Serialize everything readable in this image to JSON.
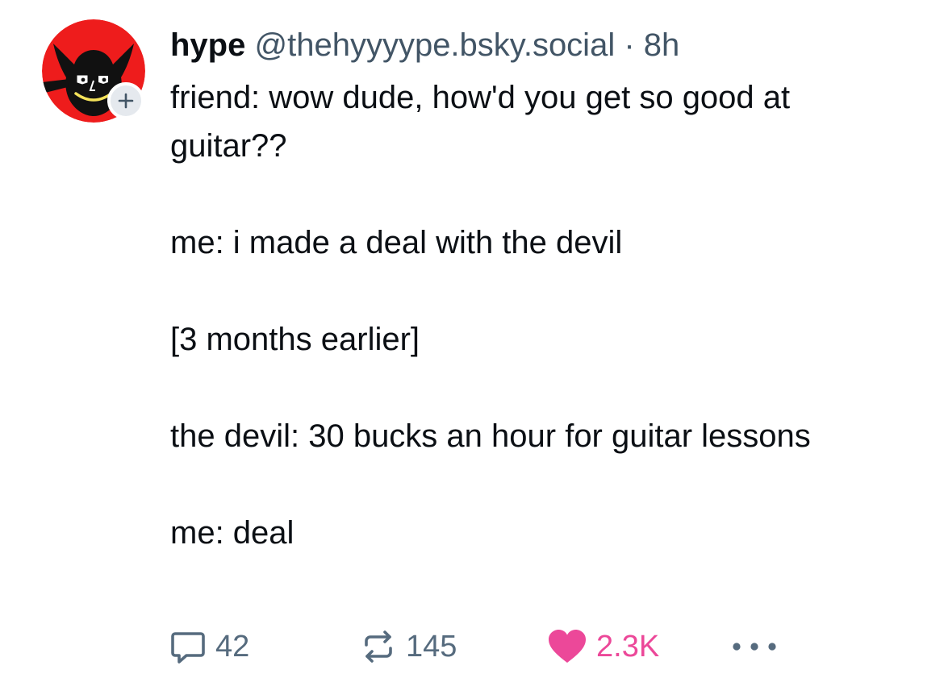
{
  "post": {
    "author": {
      "display_name": "hype",
      "handle": "@thehyyyype.bsky.social",
      "avatar_icon": "devil-face-avatar",
      "follow_icon": "plus-icon"
    },
    "separator": "·",
    "timestamp": "8h",
    "body": {
      "lines": [
        "friend: wow dude, how'd you get so good at guitar??",
        "me: i made a deal with the devil",
        "[3 months earlier]",
        "the devil: 30 bucks an hour for guitar lessons",
        "me: deal"
      ]
    },
    "actions": {
      "reply": {
        "icon": "speech-bubble-icon",
        "count": "42"
      },
      "repost": {
        "icon": "repost-arrows-icon",
        "count": "145"
      },
      "like": {
        "icon": "heart-icon",
        "count": "2.3K",
        "color": "#ec4899"
      },
      "more": {
        "icon": "ellipsis-icon"
      }
    }
  },
  "colors": {
    "text_primary": "#0b0f14",
    "text_secondary": "#425566",
    "avatar_red": "#ee1c1c",
    "like_pink": "#ec4899"
  }
}
